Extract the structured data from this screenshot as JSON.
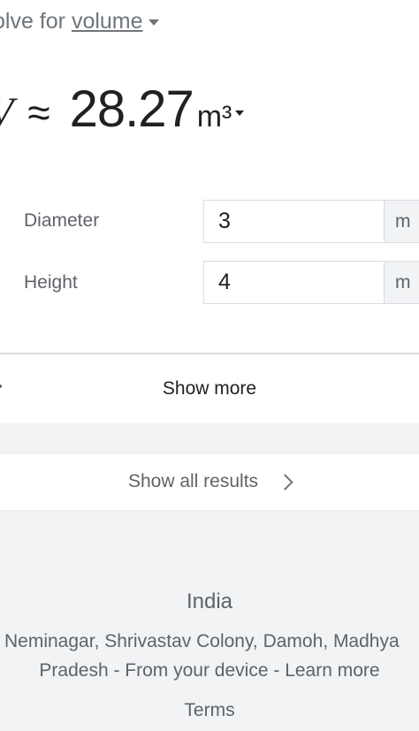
{
  "header": {
    "solve_prefix": "olve for",
    "solve_link": "volume"
  },
  "result": {
    "symbol": "V",
    "approx": "≈",
    "value": "28.27",
    "unit": "m³"
  },
  "fields": [
    {
      "label": "Diameter",
      "value": "3",
      "unit": "m"
    },
    {
      "label": "Height",
      "value": "4",
      "unit": "m"
    }
  ],
  "show_more_label": "Show more",
  "show_all_label": "Show all results",
  "footer": {
    "country": "India",
    "location_line1": "Neminagar, Shrivastav Colony, Damoh, Madhya",
    "location_line2_pre": "Pradesh - ",
    "from_device": "From your device",
    "sep": " - ",
    "learn_more": "Learn more",
    "terms": "Terms"
  }
}
